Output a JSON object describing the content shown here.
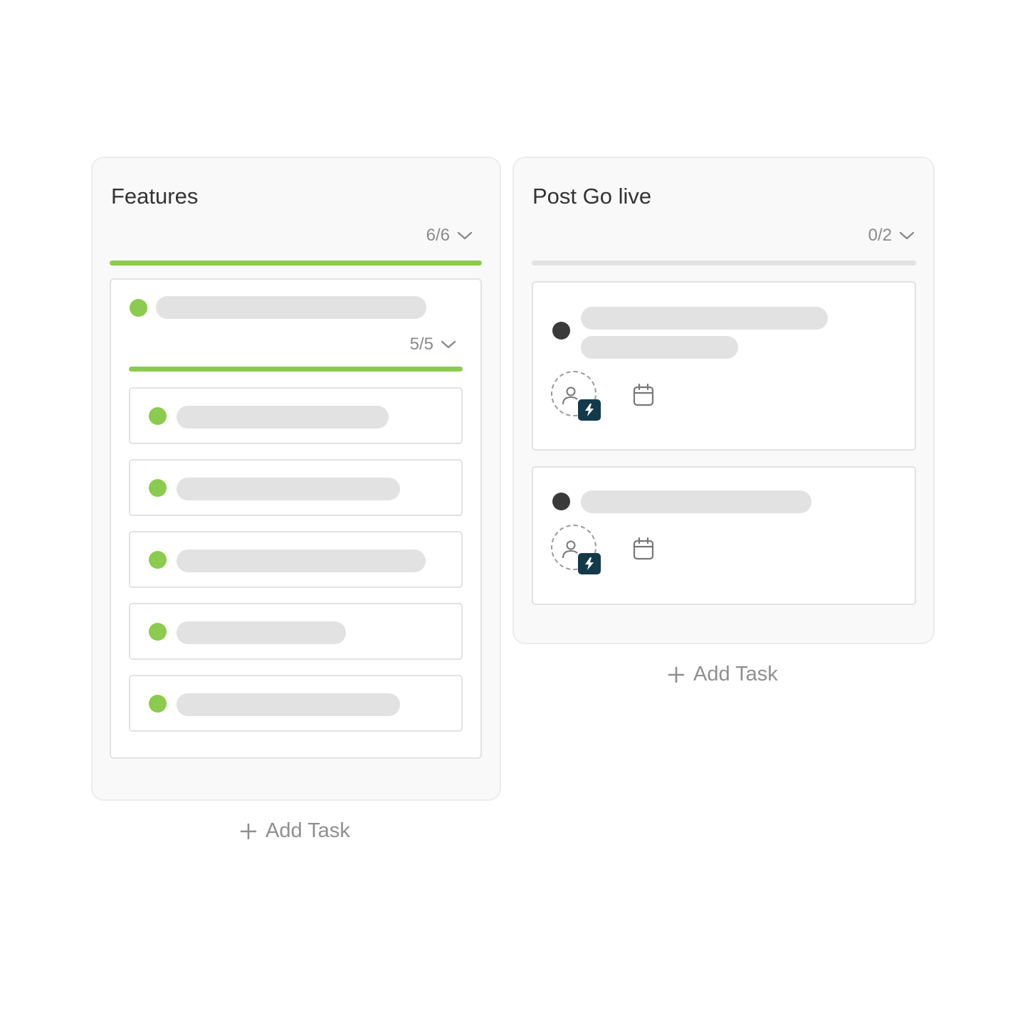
{
  "colors": {
    "done": "#8bcb4d",
    "todo": "#3a3a3a",
    "skeleton": "#e2e2e2",
    "badge": "#123a4b"
  },
  "columns": [
    {
      "title": "Features",
      "counter": "6/6",
      "progress": 1.0,
      "group": {
        "counter": "5/5",
        "progress": 1.0,
        "status": "done",
        "subtasks": [
          {
            "status": "done"
          },
          {
            "status": "done"
          },
          {
            "status": "done"
          },
          {
            "status": "done"
          },
          {
            "status": "done"
          }
        ]
      },
      "add_task": "Add Task"
    },
    {
      "title": "Post Go live",
      "counter": "0/2",
      "progress": 0.0,
      "tasks": [
        {
          "status": "todo",
          "icons": [
            "user-icon",
            "lightning-badge-icon",
            "calendar-icon"
          ]
        },
        {
          "status": "todo",
          "icons": [
            "user-icon",
            "lightning-badge-icon",
            "calendar-icon"
          ]
        }
      ],
      "add_task": "Add Task"
    }
  ]
}
